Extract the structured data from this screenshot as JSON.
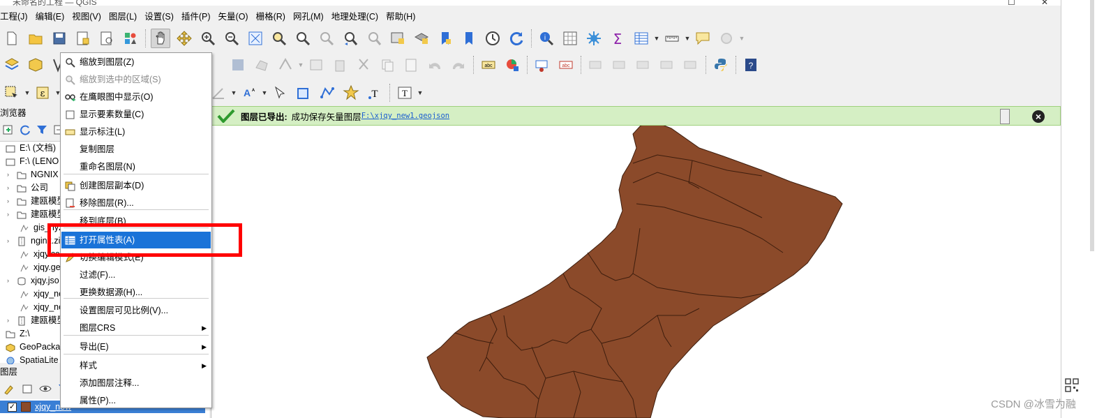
{
  "window": {
    "title": "未命名的工程 — QGIS"
  },
  "menubar": [
    "工程(J)",
    "编辑(E)",
    "视图(V)",
    "图层(L)",
    "设置(S)",
    "插件(P)",
    "矢量(O)",
    "栅格(R)",
    "网孔(M)",
    "地理处理(C)",
    "帮助(H)"
  ],
  "browser": {
    "title": "浏览器",
    "items": [
      {
        "label": "E:\\ (文档)",
        "icon": "drive-icon",
        "expand": false
      },
      {
        "label": "F:\\ (LENO",
        "icon": "drive-icon",
        "expand": false
      },
      {
        "label": "NGNIX",
        "icon": "folder-icon",
        "expand": true
      },
      {
        "label": "公司",
        "icon": "folder-icon",
        "expand": true
      },
      {
        "label": "建瓯模型",
        "icon": "folder-icon",
        "expand": true
      },
      {
        "label": "建瓯模型",
        "icon": "folder-icon",
        "expand": true
      },
      {
        "label": "gis_nyz",
        "icon": "vector-file-icon",
        "expand": false
      },
      {
        "label": "nginx.zip",
        "icon": "zip-icon",
        "expand": true
      },
      {
        "label": "xjqy.cc",
        "icon": "vector-file-icon",
        "expand": false
      },
      {
        "label": "xjqy.ge",
        "icon": "vector-file-icon",
        "expand": false
      },
      {
        "label": "xjqy.jso",
        "icon": "database-icon",
        "expand": true
      },
      {
        "label": "xjqy_ne",
        "icon": "vector-file-icon",
        "expand": false
      },
      {
        "label": "xjqy_ne",
        "icon": "vector-file-icon",
        "expand": false
      },
      {
        "label": "建瓯模型",
        "icon": "zip-icon",
        "expand": true
      },
      {
        "label": "Z:\\",
        "icon": "folder-icon",
        "expand": false
      },
      {
        "label": "GeoPacka",
        "icon": "geopackage-icon",
        "expand": false
      },
      {
        "label": "SpatiaLite",
        "icon": "spatialite-icon",
        "expand": false
      }
    ]
  },
  "layers": {
    "title": "图层",
    "items": [
      {
        "name": "xjqy_new",
        "checked": true,
        "color": "#8b4a2a"
      }
    ]
  },
  "context_menu": {
    "items": [
      {
        "label": "缩放到图层(Z)",
        "icon": "zoom-layer-icon",
        "disabled": false
      },
      {
        "label": "缩放到选中的区域(S)",
        "icon": "zoom-selection-icon",
        "disabled": true
      },
      {
        "label": "在鹰眼图中显示(O)",
        "icon": "overview-icon",
        "disabled": false
      },
      {
        "label": "显示要素数量(C)",
        "icon": "checkbox-icon",
        "disabled": false
      },
      {
        "label": "显示标注(L)",
        "icon": "label-icon",
        "disabled": false
      },
      {
        "label": "复制图层",
        "icon": "",
        "disabled": false
      },
      {
        "label": "重命名图层(N)",
        "icon": "",
        "disabled": false
      },
      {
        "label": "创建图层副本(D)",
        "icon": "duplicate-layer-icon",
        "disabled": false
      },
      {
        "label": "移除图层(R)...",
        "icon": "remove-layer-icon",
        "disabled": false
      },
      {
        "label": "移到底层(B)",
        "icon": "",
        "disabled": false
      },
      {
        "label": "打开属性表(A)",
        "icon": "attribute-table-icon",
        "disabled": false,
        "highlighted": true
      },
      {
        "label": "切换编辑模式(E)",
        "icon": "pencil-icon",
        "disabled": false
      },
      {
        "label": "过滤(F)...",
        "icon": "",
        "disabled": false
      },
      {
        "label": "更换数据源(H)...",
        "icon": "",
        "disabled": false
      },
      {
        "label": "设置图层可见比例(V)...",
        "icon": "",
        "disabled": false
      },
      {
        "label": "图层CRS",
        "icon": "",
        "disabled": false,
        "submenu": true
      },
      {
        "label": "导出(E)",
        "icon": "",
        "disabled": false,
        "submenu": true
      },
      {
        "label": "样式",
        "icon": "",
        "disabled": false,
        "submenu": true
      },
      {
        "label": "添加图层注释...",
        "icon": "",
        "disabled": false
      },
      {
        "label": "属性(P)...",
        "icon": "",
        "disabled": false
      }
    ]
  },
  "message_bar": {
    "title": "图层已导出:",
    "message": "成功保存矢量图层",
    "link": "F:\\xjqy_new1.geojson",
    "status_color": "#d5efc4"
  },
  "map": {
    "fill_color": "#8b4a2a",
    "stroke_color": "#3d1d0d"
  },
  "watermark": "CSDN @冰雪为融",
  "colors": {
    "highlight": "#1a73d8",
    "annotation_box": "#ff0000"
  }
}
